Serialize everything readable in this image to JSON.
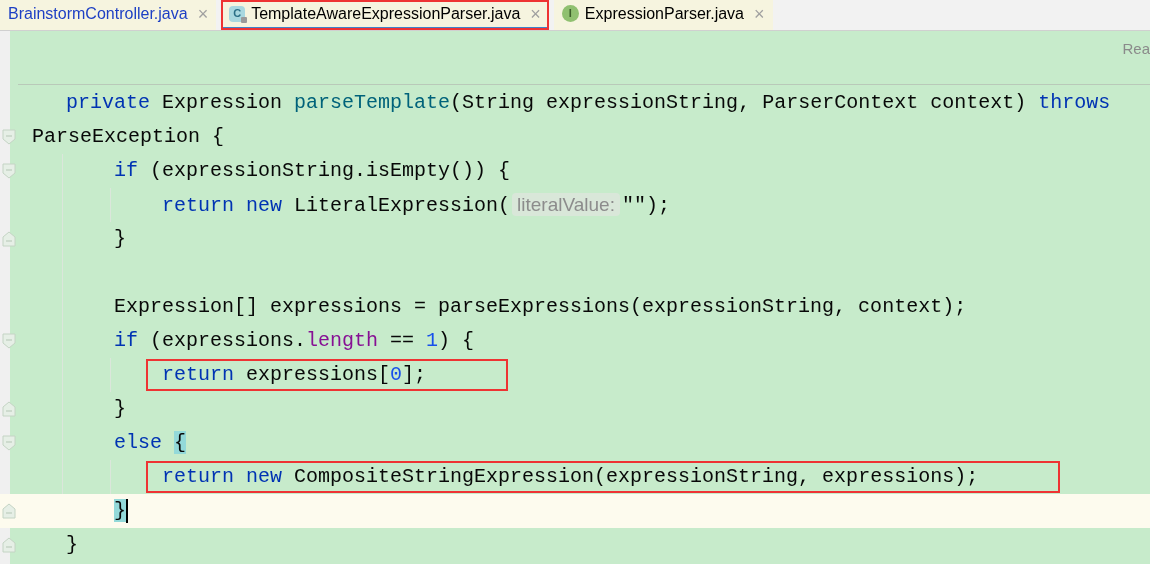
{
  "tabs": [
    {
      "label": "BrainstormController.java",
      "selected": false,
      "color": "#1d3fc4",
      "close": "×",
      "boxed": false
    },
    {
      "label": "TemplateAwareExpressionParser.java",
      "selected": true,
      "badge": {
        "kind": "class",
        "letter": "C"
      },
      "close": "×",
      "boxed": true
    },
    {
      "label": "ExpressionParser.java",
      "selected": false,
      "badge": {
        "kind": "interface",
        "letter": "I"
      },
      "close": "×",
      "boxed": false
    }
  ],
  "editor": {
    "corner_text": "Rea",
    "lines": [
      {
        "tokens": [
          {
            "t": "private",
            "kind": "keyword"
          },
          {
            "t": " Expression ",
            "kind": "plain"
          },
          {
            "t": "parseTemplate",
            "kind": "method"
          },
          {
            "t": "(String expressionString, ParserContext context) ",
            "kind": "plain"
          },
          {
            "t": "throws",
            "kind": "keyword"
          }
        ],
        "continuation": {
          "gutter": {
            "kind": "fold-start"
          },
          "tokens": [
            {
              "t": "ParseException {",
              "kind": "plain"
            }
          ]
        },
        "children": [
          {
            "gutter": {
              "kind": "fold-start"
            },
            "tokens": [
              {
                "t": "if",
                "kind": "keyword"
              },
              {
                "t": " (expressionString.isEmpty()) {",
                "kind": "plain"
              }
            ],
            "children": [
              {
                "tokens": [
                  {
                    "t": "return",
                    "kind": "keyword"
                  },
                  {
                    "t": " new",
                    "kind": "keyword"
                  },
                  {
                    "t": " LiteralExpression(",
                    "kind": "plain"
                  },
                  {
                    "t": "literalValue:",
                    "kind": "hint"
                  },
                  {
                    "t": "\"\");",
                    "kind": "plain"
                  }
                ]
              }
            ]
          },
          {
            "gutter": {
              "kind": "fold-end"
            },
            "tokens": [
              {
                "t": "}",
                "kind": "plain"
              }
            ]
          },
          {
            "kind": "blank"
          },
          {
            "tokens": [
              {
                "t": "Expression[] expressions = parseExpressions(expressionString, context);",
                "kind": "plain"
              }
            ]
          },
          {
            "gutter": {
              "kind": "fold-start"
            },
            "tokens": [
              {
                "t": "if",
                "kind": "keyword"
              },
              {
                "t": " (expressions.",
                "kind": "plain"
              },
              {
                "t": "length",
                "kind": "field"
              },
              {
                "t": " == ",
                "kind": "plain"
              },
              {
                "t": "1",
                "kind": "number"
              },
              {
                "t": ") {",
                "kind": "plain"
              }
            ],
            "children": [
              {
                "boxed": true,
                "tokens": [
                  {
                    "t": "return",
                    "kind": "keyword"
                  },
                  {
                    "t": " expressions[",
                    "kind": "plain"
                  },
                  {
                    "t": "0",
                    "kind": "number"
                  },
                  {
                    "t": "];",
                    "kind": "plain"
                  }
                ]
              }
            ]
          },
          {
            "gutter": {
              "kind": "fold-end"
            },
            "tokens": [
              {
                "t": "}",
                "kind": "plain"
              }
            ]
          },
          {
            "gutter": {
              "kind": "fold-start"
            },
            "tokens": [
              {
                "t": "else ",
                "kind": "keyword"
              },
              {
                "t": "{",
                "kind": "match"
              }
            ],
            "children": [
              {
                "boxed": true,
                "tokens": [
                  {
                    "t": "return",
                    "kind": "keyword"
                  },
                  {
                    "t": " new",
                    "kind": "keyword"
                  },
                  {
                    "t": " CompositeStringExpression(expressionString, expressions);",
                    "kind": "plain"
                  }
                ]
              }
            ]
          },
          {
            "gutter": {
              "kind": "fold-end"
            },
            "current": true,
            "caret": true,
            "tokens": [
              {
                "t": "}",
                "kind": "match"
              }
            ]
          }
        ]
      },
      {
        "gutter": {
          "kind": "fold-end"
        },
        "tokens": [
          {
            "t": "}",
            "kind": "plain"
          }
        ]
      }
    ]
  }
}
